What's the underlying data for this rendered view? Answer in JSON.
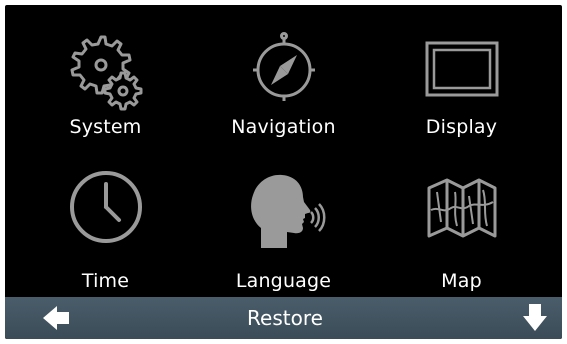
{
  "menu": {
    "items": [
      {
        "label": "System",
        "icon": "gears-icon"
      },
      {
        "label": "Navigation",
        "icon": "compass-icon"
      },
      {
        "label": "Display",
        "icon": "display-icon"
      },
      {
        "label": "Time",
        "icon": "clock-icon"
      },
      {
        "label": "Language",
        "icon": "speaking-head-icon"
      },
      {
        "label": "Map",
        "icon": "map-icon"
      }
    ]
  },
  "bottombar": {
    "restore_label": "Restore",
    "back_icon": "arrow-left-icon",
    "scroll_icon": "arrow-down-icon"
  },
  "colors": {
    "background": "#000000",
    "icon_stroke": "#9a9a9a",
    "bar": "#445663",
    "text": "#ffffff"
  }
}
